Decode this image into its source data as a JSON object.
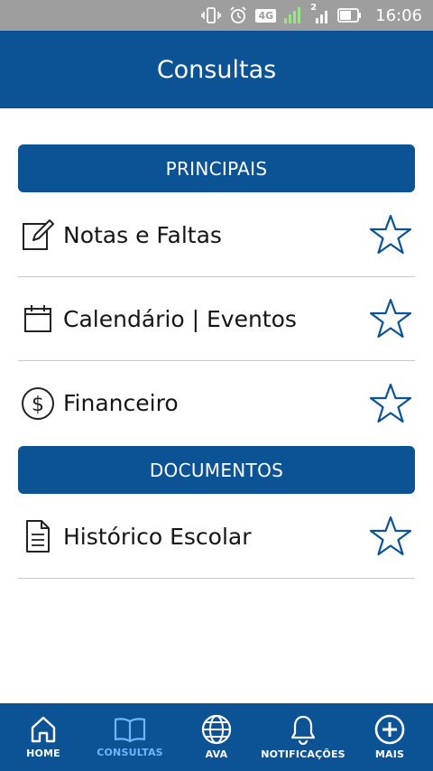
{
  "status_bar": {
    "network": "4G",
    "sim_badge": "2",
    "time": "16:06"
  },
  "header": {
    "title": "Consultas"
  },
  "sections": [
    {
      "title": "PRINCIPAIS",
      "items": [
        {
          "label": "Notas e Faltas",
          "icon": "edit-note-icon"
        },
        {
          "label": "Calendário | Eventos",
          "icon": "calendar-icon"
        },
        {
          "label": "Financeiro",
          "icon": "dollar-icon"
        }
      ]
    },
    {
      "title": "DOCUMENTOS",
      "items": [
        {
          "label": "Histórico Escolar",
          "icon": "document-icon"
        }
      ]
    }
  ],
  "bottom_nav": [
    {
      "label": "HOME",
      "icon": "home-icon"
    },
    {
      "label": "CONSULTAS",
      "icon": "book-icon",
      "active": true
    },
    {
      "label": "AVA",
      "icon": "globe-icon"
    },
    {
      "label": "NOTIFICAÇÕES",
      "icon": "bell-icon"
    },
    {
      "label": "MAIS",
      "icon": "plus-circle-icon"
    }
  ],
  "colors": {
    "brand_blue": "#0b5394",
    "active_nav": "#6fb6ff",
    "status_bar": "#9e9e9e",
    "star_outline": "#0b5394"
  }
}
